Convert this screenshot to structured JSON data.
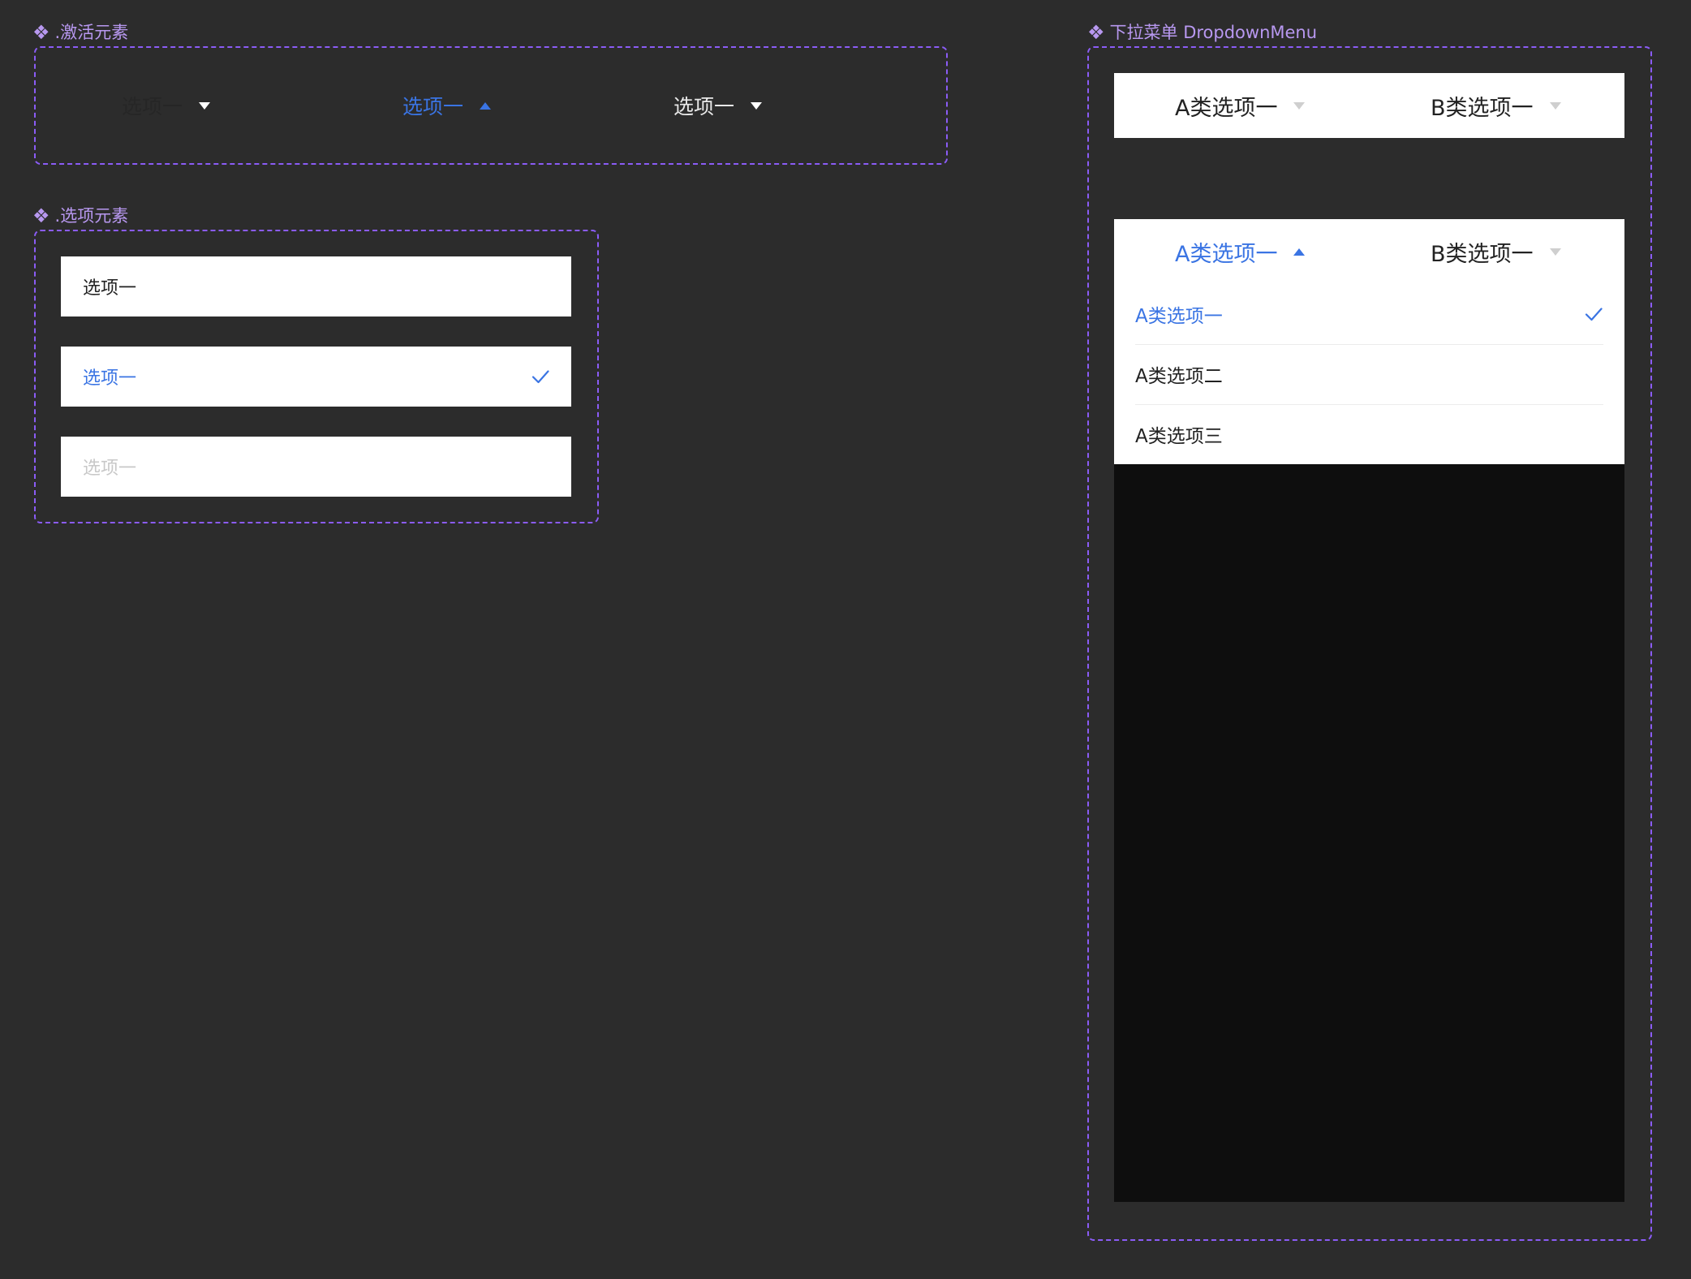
{
  "colors": {
    "background": "#2c2c2c",
    "frame_border": "#8b5cf6",
    "label_purple": "#b898f0",
    "accent_blue": "#3a74e3",
    "text_dark": "#222222",
    "text_disabled": "#c8c8c8",
    "overlay": "#0e0e0e"
  },
  "activation_frame": {
    "label": ".激活元素",
    "items": [
      {
        "label": "选项一",
        "state": "default",
        "icon": "caret-down-icon"
      },
      {
        "label": "选项一",
        "state": "active",
        "icon": "caret-up-icon"
      },
      {
        "label": "选项一",
        "state": "default-light",
        "icon": "caret-down-icon"
      }
    ]
  },
  "option_frame": {
    "label": ".选项元素",
    "items": [
      {
        "label": "选项一",
        "state": "normal"
      },
      {
        "label": "选项一",
        "state": "selected",
        "icon": "check-icon"
      },
      {
        "label": "选项一",
        "state": "disabled"
      }
    ]
  },
  "dropdown_frame": {
    "label": "下拉菜单 DropdownMenu",
    "collapsed": {
      "titles": [
        {
          "label": "A类选项一",
          "icon": "caret-down-icon"
        },
        {
          "label": "B类选项一",
          "icon": "caret-down-icon"
        }
      ]
    },
    "expanded": {
      "titles": [
        {
          "label": "A类选项一",
          "icon": "caret-up-icon",
          "active": true
        },
        {
          "label": "B类选项一",
          "icon": "caret-down-icon"
        }
      ],
      "options": [
        {
          "label": "A类选项一",
          "selected": true,
          "icon": "check-icon"
        },
        {
          "label": "A类选项二",
          "selected": false
        },
        {
          "label": "A类选项三",
          "selected": false
        }
      ]
    }
  }
}
